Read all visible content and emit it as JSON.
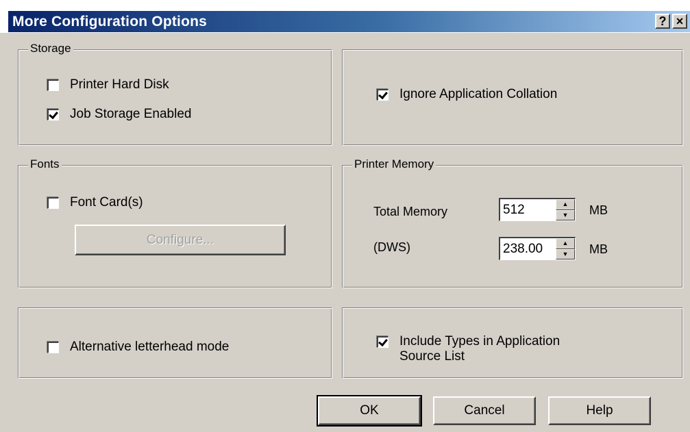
{
  "window": {
    "title": "More Configuration Options",
    "help_button": "?",
    "close_button": "×"
  },
  "storage": {
    "legend": "Storage",
    "printer_hard_disk": {
      "label": "Printer Hard Disk",
      "checked": false
    },
    "job_storage": {
      "label": "Job Storage Enabled",
      "checked": true
    }
  },
  "collation": {
    "label": "Ignore Application Collation",
    "checked": true
  },
  "fonts": {
    "legend": "Fonts",
    "font_cards": {
      "label": "Font Card(s)",
      "checked": false
    },
    "configure_button": "Configure..."
  },
  "memory": {
    "legend": "Printer Memory",
    "total_label": "Total Memory",
    "total_value": "512",
    "total_unit": "MB",
    "dws_label": "(DWS)",
    "dws_value": "238.00",
    "dws_unit": "MB"
  },
  "letterhead": {
    "label": "Alternative letterhead mode",
    "checked": false
  },
  "include_types": {
    "label_line1": "Include Types in Application",
    "label_line2": "Source List",
    "checked": true
  },
  "buttons": {
    "ok": "OK",
    "cancel": "Cancel",
    "help": "Help"
  }
}
